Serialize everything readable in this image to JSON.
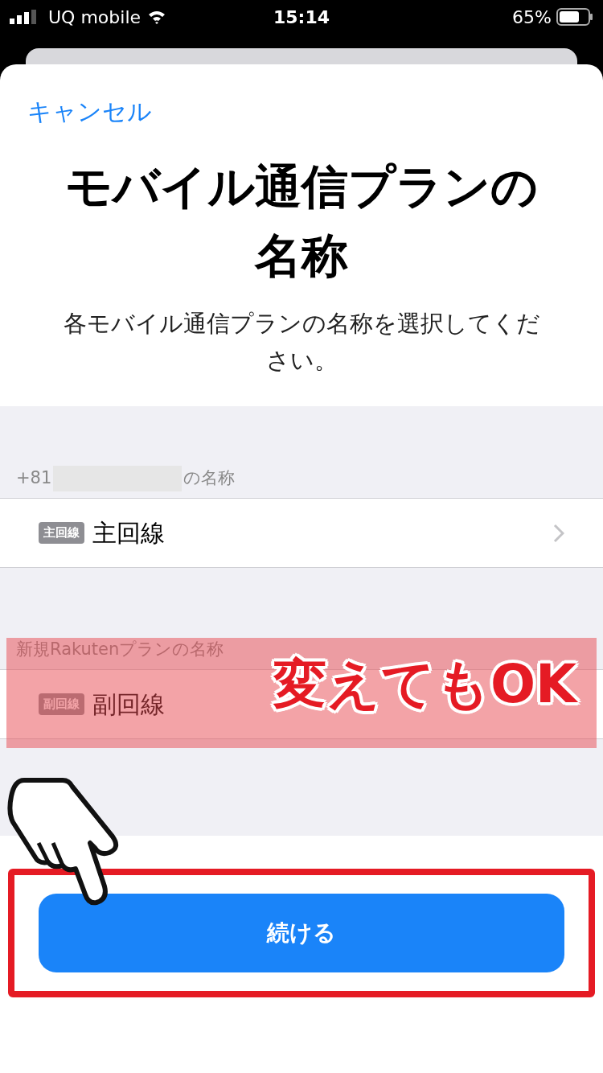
{
  "status_bar": {
    "carrier": "UQ mobile",
    "time": "15:14",
    "battery": "65%"
  },
  "cancel": "キャンセル",
  "title": "モバイル通信プランの名称",
  "subtitle": "各モバイル通信プランの名称を選択してください。",
  "sections": [
    {
      "header": "+81",
      "header_after": "の名称",
      "badge": "主回線",
      "value": "主回線",
      "chevron": true
    },
    {
      "header": "新規Rakutenプランの名称",
      "badge": "副回線",
      "value": "副回線",
      "chevron": false
    }
  ],
  "annotation": "変えてもOK",
  "button": "続ける"
}
